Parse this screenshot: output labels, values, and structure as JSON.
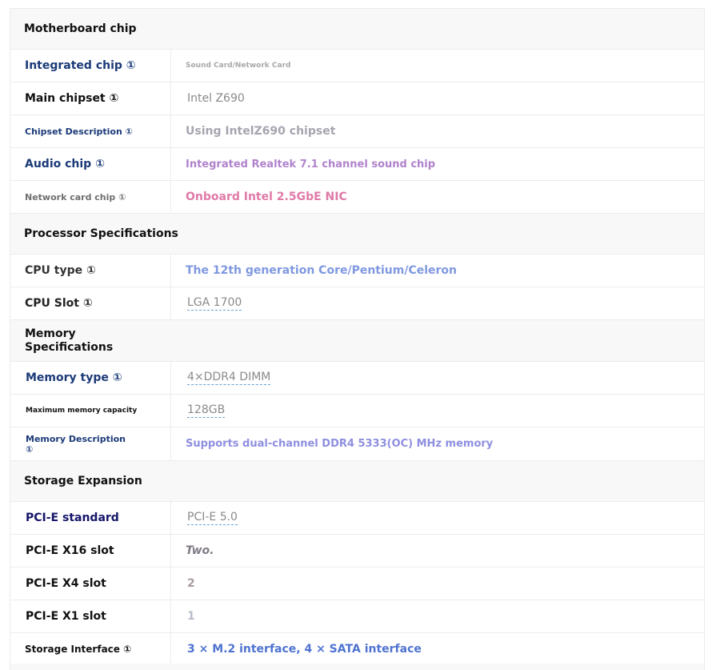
{
  "sections": [
    {
      "title": "Motherboard chip",
      "rows": [
        {
          "label": "Integrated chip ①",
          "value": "Sound Card/Network Card"
        },
        {
          "label": "Main chipset ①",
          "value": "Intel Z690"
        },
        {
          "label": "Chipset Description ①",
          "value": "Using IntelZ690 chipset"
        },
        {
          "label": "Audio chip ①",
          "value": "Integrated Realtek 7.1 channel sound chip"
        },
        {
          "label": "Network card chip ①",
          "value": "Onboard Intel 2.5GbE NIC"
        }
      ]
    },
    {
      "title": "Processor Specifications",
      "rows": [
        {
          "label": "CPU type ①",
          "value": "The 12th generation Core/Pentium/Celeron"
        },
        {
          "label": "CPU Slot ①",
          "value": "LGA 1700"
        }
      ]
    },
    {
      "title": "Memory Specifications",
      "rows": [
        {
          "label": "Memory type ①",
          "value": "4×DDR4 DIMM"
        },
        {
          "label": "Maximum memory capacity",
          "value": "128GB"
        },
        {
          "label": "Memory Description ①",
          "value": "Supports dual-channel DDR4 5333(OC) MHz memory"
        }
      ]
    },
    {
      "title": "Storage Expansion",
      "rows": [
        {
          "label": "PCI-E standard",
          "value": "PCI-E 5.0"
        },
        {
          "label": "PCI-E X16 slot",
          "value": "Two."
        },
        {
          "label": "PCI-E X4 slot",
          "value": "2"
        },
        {
          "label": "PCI-E X1 slot",
          "value": "1"
        },
        {
          "label": "Storage Interface ①",
          "value": "3 × M.2 interface, 4 × SATA interface"
        }
      ]
    }
  ],
  "colors": {
    "header_bg": "#f8f8f8",
    "border": "#ececec",
    "dashed_underline": "#6aa3d6"
  }
}
